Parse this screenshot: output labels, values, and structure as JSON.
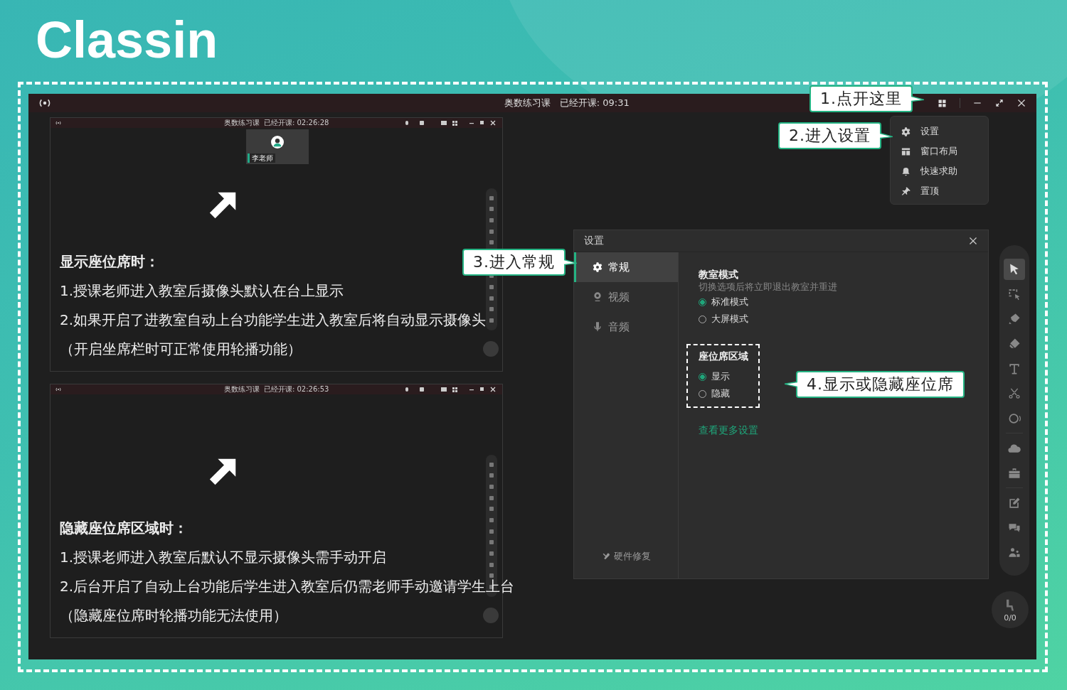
{
  "logo": "Classin",
  "window": {
    "title": "奥数练习课",
    "elapsed": "已经开课: 09:31"
  },
  "menu": {
    "items": [
      {
        "label": "设置",
        "kind": "gear"
      },
      {
        "label": "窗口布局",
        "kind": "layout"
      },
      {
        "label": "快速求助",
        "kind": "bell"
      },
      {
        "label": "置顶",
        "kind": "pin"
      }
    ]
  },
  "previews": [
    {
      "title": "奥数练习课",
      "elapsed": "已经开课: 02:26:28",
      "teacher": "李老师",
      "heading": "显示座位席时：",
      "lines": [
        "1.授课老师进入教室后摄像头默认在台上显示",
        "2.如果开启了进教室自动上台功能学生进入教室后将自动显示摄像头",
        "（开启坐席栏时可正常使用轮播功能）"
      ]
    },
    {
      "title": "奥数练习课",
      "elapsed": "已经开课: 02:26:53",
      "heading": "隐藏座位席区域时：",
      "lines": [
        "1.授课老师进入教室后默认不显示摄像头需手动开启",
        "2.后台开启了自动上台功能后学生进入教室后仍需老师手动邀请学生上台",
        "（隐藏座位席时轮播功能无法使用）"
      ]
    }
  ],
  "settings": {
    "title": "设置",
    "tabs": [
      {
        "label": "常规",
        "kind": "gear",
        "selected": true
      },
      {
        "label": "视频",
        "kind": "camera",
        "selected": false
      },
      {
        "label": "音频",
        "kind": "mic",
        "selected": false
      }
    ],
    "repair": "硬件修复",
    "sections": [
      {
        "title": "教室模式",
        "hint": "切换选项后将立即退出教室并重进",
        "highlighted": false,
        "options": [
          {
            "label": "标准模式",
            "selected": true
          },
          {
            "label": "大屏模式",
            "selected": false
          }
        ]
      },
      {
        "title": "座位席区域",
        "highlighted": true,
        "options": [
          {
            "label": "显示",
            "selected": true
          },
          {
            "label": "隐藏",
            "selected": false
          }
        ]
      }
    ],
    "more_link": "查看更多设置"
  },
  "toolbar": {
    "groups": [
      [
        {
          "kind": "pointer",
          "selected": true
        },
        {
          "kind": "select",
          "selected": false
        },
        {
          "kind": "pen",
          "selected": false
        },
        {
          "kind": "eraser",
          "selected": false
        },
        {
          "kind": "text",
          "selected": false
        },
        {
          "kind": "scissors",
          "selected": false
        },
        {
          "kind": "ring",
          "selected": false
        }
      ],
      [
        {
          "kind": "cloud",
          "selected": false
        },
        {
          "kind": "toolbox",
          "selected": false
        }
      ],
      [
        {
          "kind": "edit",
          "selected": false
        },
        {
          "kind": "chat",
          "selected": false
        },
        {
          "kind": "users",
          "selected": false
        }
      ]
    ]
  },
  "seat_counter": "0/0",
  "callouts": [
    {
      "text": "1.点开这里",
      "kind": "right"
    },
    {
      "text": "2.进入设置",
      "kind": "right"
    },
    {
      "text": "3.进入常规",
      "kind": "right"
    },
    {
      "text": "4.显示或隐藏座位席",
      "kind": "left"
    }
  ]
}
